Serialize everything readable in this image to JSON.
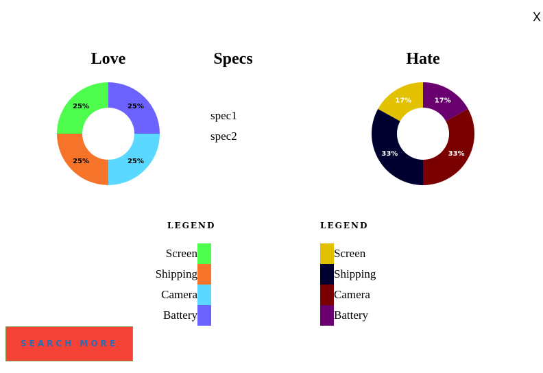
{
  "close_label": "X",
  "headings": {
    "love": "Love",
    "specs": "Specs",
    "hate": "Hate"
  },
  "specs": [
    "spec1",
    "spec2"
  ],
  "love_chart": {
    "slices": [
      {
        "name": "Screen",
        "value": 25,
        "label": "25%",
        "color": "#4efc4e",
        "text_color": "#000000"
      },
      {
        "name": "Shipping",
        "value": 25,
        "label": "25%",
        "color": "#f5742a",
        "text_color": "#000000"
      },
      {
        "name": "Camera",
        "value": 25,
        "label": "25%",
        "color": "#5bd8ff",
        "text_color": "#000000"
      },
      {
        "name": "Battery",
        "value": 25,
        "label": "25%",
        "color": "#6c63ff",
        "text_color": "#000000"
      }
    ]
  },
  "hate_chart": {
    "slices": [
      {
        "name": "Screen",
        "value": 17,
        "label": "17%",
        "color": "#e2c200",
        "text_color": "#ffffff"
      },
      {
        "name": "Shipping",
        "value": 33,
        "label": "33%",
        "color": "#000030",
        "text_color": "#ffffff"
      },
      {
        "name": "Camera",
        "value": 33,
        "label": "33%",
        "color": "#7a0000",
        "text_color": "#ffffff"
      },
      {
        "name": "Battery",
        "value": 17,
        "label": "17%",
        "color": "#6a0070",
        "text_color": "#ffffff"
      }
    ]
  },
  "legend_title": "LEGEND",
  "legend_love": [
    {
      "label": "Screen",
      "color": "#4efc4e"
    },
    {
      "label": "Shipping",
      "color": "#f5742a"
    },
    {
      "label": "Camera",
      "color": "#5bd8ff"
    },
    {
      "label": "Battery",
      "color": "#6c63ff"
    }
  ],
  "legend_hate": [
    {
      "label": "Screen",
      "color": "#e2c200"
    },
    {
      "label": "Shipping",
      "color": "#000030"
    },
    {
      "label": "Camera",
      "color": "#7a0000"
    },
    {
      "label": "Battery",
      "color": "#6a0070"
    }
  ],
  "search_button_label": "SEARCH MORE"
}
